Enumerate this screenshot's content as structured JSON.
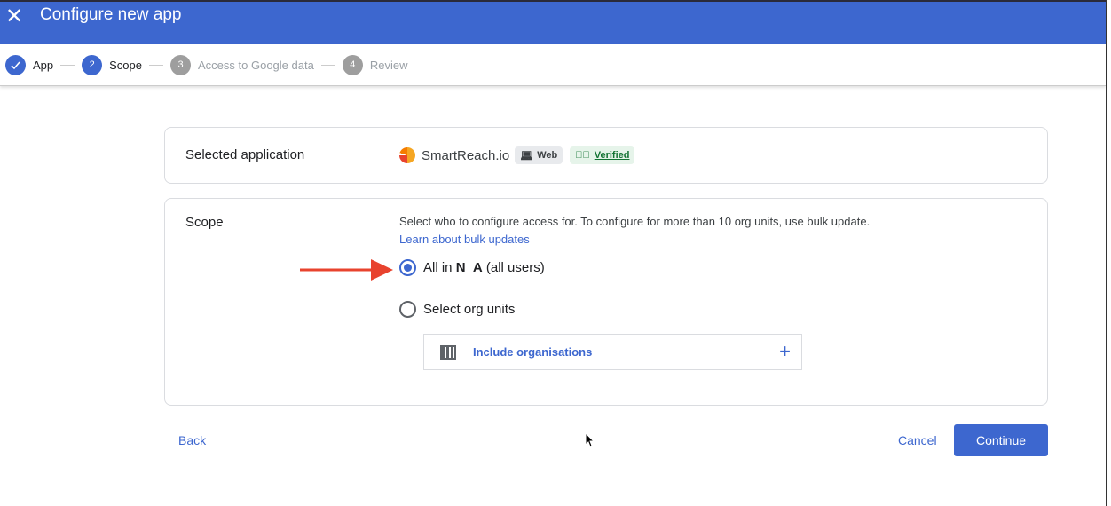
{
  "header": {
    "title": "Configure new app",
    "close_icon": "close-icon"
  },
  "steps": [
    {
      "num": "",
      "label": "App",
      "state": "done"
    },
    {
      "num": "2",
      "label": "Scope",
      "state": "active"
    },
    {
      "num": "3",
      "label": "Access to Google data",
      "state": "todo"
    },
    {
      "num": "4",
      "label": "Review",
      "state": "todo"
    }
  ],
  "selected_app": {
    "label": "Selected application",
    "name": "SmartReach.io",
    "type_chip": "Web",
    "verified_chip": "Verified"
  },
  "scope": {
    "label": "Scope",
    "description": "Select who to configure access for. To configure for more than 10 org units, use bulk update.",
    "link": "Learn about bulk updates",
    "option_all_prefix": "All in ",
    "option_all_org": "N_A",
    "option_all_suffix": " (all users)",
    "option_select": "Select org units",
    "include_label": "Include organisations",
    "selected": "all"
  },
  "footer": {
    "back": "Back",
    "cancel": "Cancel",
    "continue": "Continue"
  },
  "colors": {
    "accent": "#3d67cf",
    "annotation_arrow": "#e8432e",
    "verified_bg": "#e6f4ea",
    "verified_text": "#137333"
  }
}
